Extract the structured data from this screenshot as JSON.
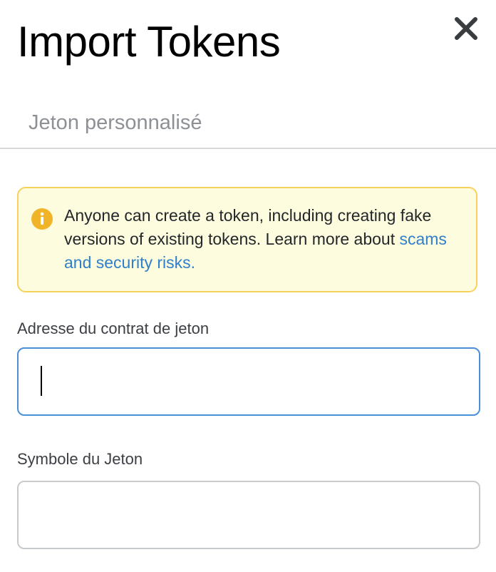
{
  "header": {
    "title": "Import Tokens",
    "close_icon": "close-icon"
  },
  "tabs": [
    {
      "label": "Jeton personnalisé"
    }
  ],
  "warning": {
    "icon": "info-icon",
    "text_before_link": "Anyone can create a token, including creating fake versions of existing tokens. Learn more about ",
    "link_text": "scams and security risks.",
    "colors": {
      "background": "#fefcde",
      "border": "#f8d15d",
      "icon": "#f0b429",
      "link": "#2f7fcb"
    }
  },
  "form": {
    "address_label": "Adresse du contrat de jeton",
    "address_value": "",
    "symbol_label": "Symbole du Jeton",
    "symbol_value": ""
  },
  "colors": {
    "input_focus_border": "#4a8fd7",
    "input_border": "#c8cbce",
    "tab_text": "#8d9196"
  }
}
